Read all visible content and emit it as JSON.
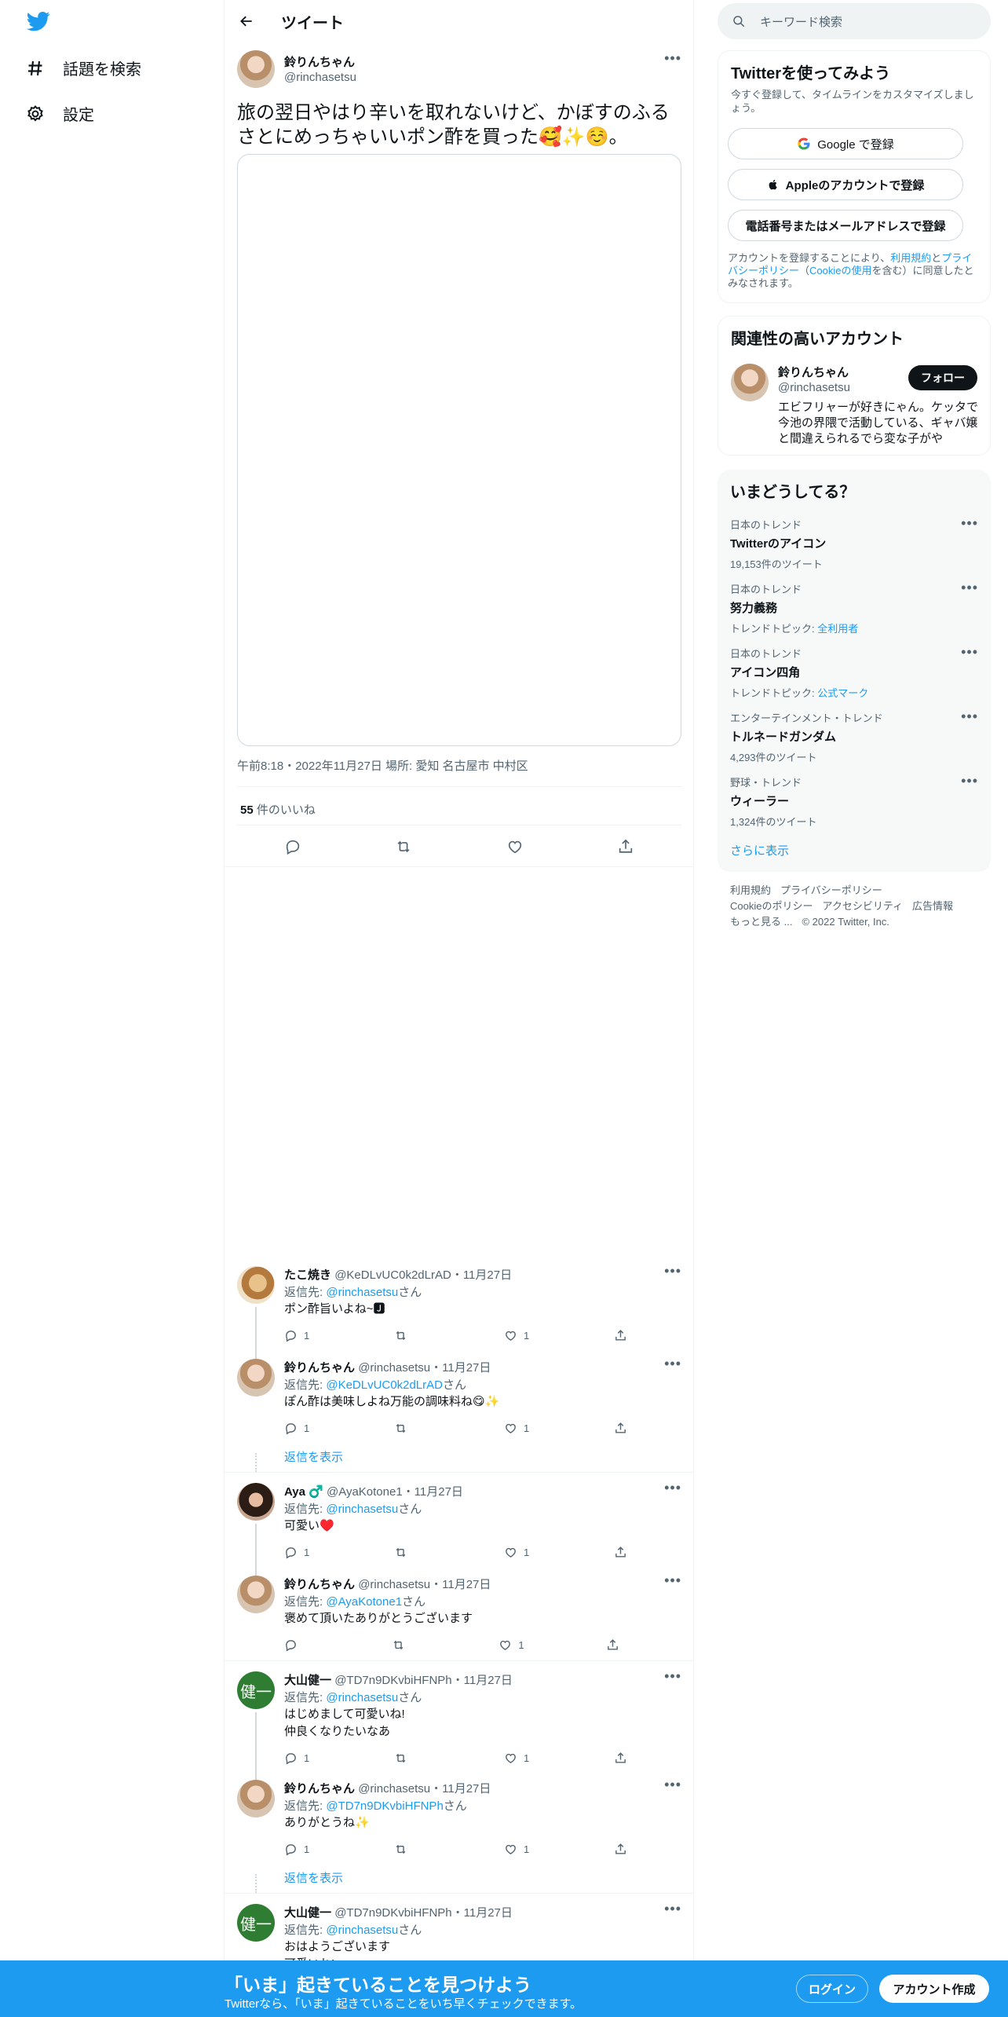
{
  "colors": {
    "accent": "#1d9bf0",
    "text": "#0f1419",
    "muted": "#536471",
    "border": "#cfd9de",
    "trend_bg": "#f7f9f9",
    "bottom_bar": "#1d9bf0"
  },
  "left_nav": {
    "logo": "twitter-bird-icon",
    "items": [
      {
        "icon": "hashtag-icon",
        "label": "話題を検索"
      },
      {
        "icon": "gear-icon",
        "label": "設定"
      }
    ]
  },
  "header": {
    "title": "ツイート",
    "back_icon": "arrow-left-icon"
  },
  "tweet": {
    "name": "鈴りんちゃん",
    "handle": "@rinchasetsu",
    "text": "旅の翌日やはり辛いを取れないけど、かぼすのふるさとにめっちゃいいポン酢を買った🥰✨☺️。",
    "meta": "午前8:18・2022年11月27日 場所: 愛知 名古屋市 中村区",
    "likes_count": "55",
    "likes_label": "件のいいね"
  },
  "replies": [
    {
      "name": "たこ焼き",
      "handle": "@KeDLvUC0k2dLrAD",
      "date": "・11月27日",
      "to_label": "返信先: ",
      "to": "@rinchasetsu",
      "to_suffix": "さん",
      "body": "ポン酢旨いよね~🅹",
      "reply_count": "1",
      "retweet_count": "",
      "like_count": "1",
      "avatar": "tako"
    },
    {
      "name": "鈴りんちゃん",
      "handle": "@rinchasetsu",
      "date": "・11月27日",
      "to_label": "返信先: ",
      "to": "@KeDLvUC0k2dLrAD",
      "to_suffix": "さん",
      "body": "ぽん酢は美味しよね万能の調味料ね😋✨",
      "reply_count": "1",
      "retweet_count": "",
      "like_count": "1",
      "avatar": "rin",
      "show_more": "返信を表示"
    },
    {
      "name": "Aya ♂️",
      "handle": "@AyaKotone1",
      "date": "・11月27日",
      "to_label": "返信先: ",
      "to": "@rinchasetsu",
      "to_suffix": "さん",
      "body": "可愛い♥️",
      "reply_count": "1",
      "retweet_count": "",
      "like_count": "1",
      "avatar": "aya"
    },
    {
      "name": "鈴りんちゃん",
      "handle": "@rinchasetsu",
      "date": "・11月27日",
      "to_label": "返信先: ",
      "to": "@AyaKotone1",
      "to_suffix": "さん",
      "body": "褒めて頂いたありがとうございます",
      "reply_count": "",
      "retweet_count": "",
      "like_count": "1",
      "avatar": "rin"
    },
    {
      "name": "大山健一",
      "handle": "@TD7n9DKvbiHFNPh",
      "date": "・11月27日",
      "to_label": "返信先: ",
      "to": "@rinchasetsu",
      "to_suffix": "さん",
      "body": "はじめまして可愛いね!\n仲良くなりたいなあ",
      "reply_count": "1",
      "retweet_count": "",
      "like_count": "1",
      "avatar": "ken",
      "avatar_text": "健一"
    },
    {
      "name": "鈴りんちゃん",
      "handle": "@rinchasetsu",
      "date": "・11月27日",
      "to_label": "返信先: ",
      "to": "@TD7n9DKvbiHFNPh",
      "to_suffix": "さん",
      "body": "ありがとうね✨",
      "reply_count": "1",
      "retweet_count": "",
      "like_count": "1",
      "avatar": "rin",
      "show_more": "返信を表示"
    },
    {
      "name": "大山健一",
      "handle": "@TD7n9DKvbiHFNPh",
      "date": "・11月27日",
      "to_label": "返信先: ",
      "to": "@rinchasetsu",
      "to_suffix": "さん",
      "body": "おはようございます\n可愛いね!",
      "avatar": "ken",
      "avatar_text": "健一"
    }
  ],
  "search": {
    "placeholder": "キーワード検索",
    "icon": "search-icon"
  },
  "signup": {
    "title": "Twitterを使ってみよう",
    "subtitle": "今すぐ登録して、タイムラインをカスタマイズしましょう。",
    "google": "Google で登録",
    "apple": "Appleのアカウントで登録",
    "phone": "電話番号またはメールアドレスで登録",
    "legal_1": "アカウントを登録することにより、",
    "legal_terms": "利用規約",
    "legal_2": "と",
    "legal_privacy": "プライバシーポリシー",
    "legal_3": "（",
    "legal_cookie": "Cookieの使用",
    "legal_4": "を含む）に同意したとみなされます。"
  },
  "related": {
    "title": "関連性の高いアカウント",
    "name": "鈴りんちゃん",
    "handle": "@rinchasetsu",
    "follow": "フォロー",
    "bio": "エビフリャーが好きにゃん。ケッタで今池の界隈で活動している、ギャバ嬢と間違えられるでら変な子がや"
  },
  "trends": {
    "title": "いまどうしてる？",
    "items": [
      {
        "category": "日本のトレンド",
        "name": "Twitterのアイコン",
        "sub": "19,153件のツイート",
        "sub_link": ""
      },
      {
        "category": "日本のトレンド",
        "name": "努力義務",
        "sub": "トレンドトピック: ",
        "sub_link": "全利用者"
      },
      {
        "category": "日本のトレンド",
        "name": "アイコン四角",
        "sub": "トレンドトピック: ",
        "sub_link": "公式マーク"
      },
      {
        "category": "エンターテインメント・トレンド",
        "name": "トルネードガンダム",
        "sub": "4,293件のツイート",
        "sub_link": ""
      },
      {
        "category": "野球・トレンド",
        "name": "ウィーラー",
        "sub": "1,324件のツイート",
        "sub_link": ""
      }
    ],
    "show_more": "さらに表示"
  },
  "footer": {
    "links": [
      "利用規約",
      "プライバシーポリシー",
      "Cookieのポリシー",
      "アクセシビリティ",
      "広告情報",
      "もっと見る ..."
    ],
    "copyright": "© 2022 Twitter, Inc."
  },
  "bottom_bar": {
    "title": "「いま」起きていることを見つけよう",
    "subtitle": "Twitterなら、「いま」起きていることをいち早くチェックできます。",
    "login": "ログイン",
    "signup": "アカウント作成"
  }
}
